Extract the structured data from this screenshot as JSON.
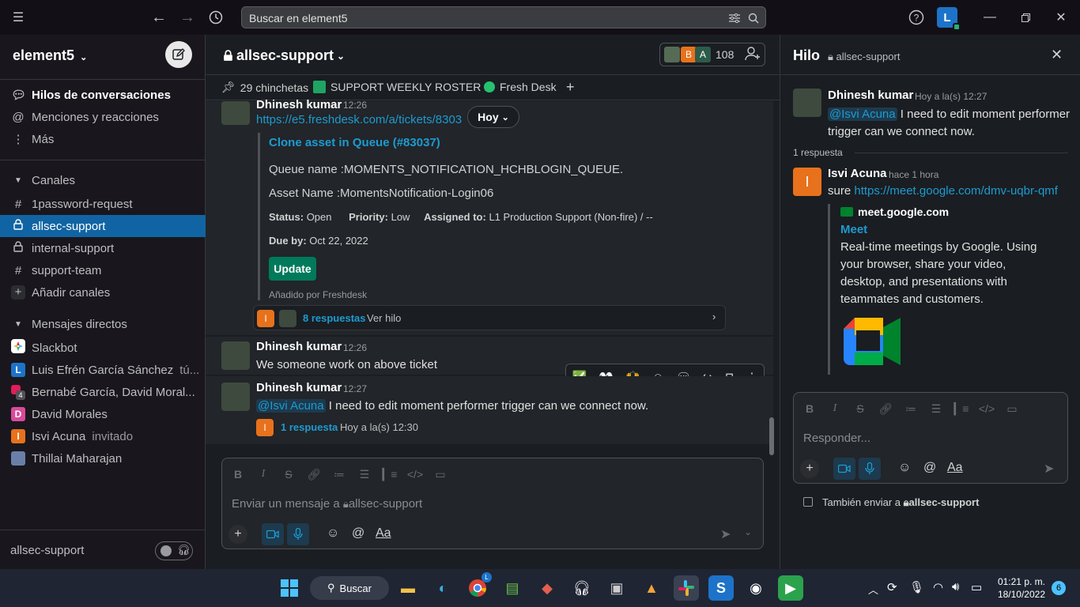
{
  "topbar": {
    "search_placeholder": "Buscar en element5",
    "user_initial": "L"
  },
  "sidebar": {
    "workspace": "element5",
    "nav": [
      {
        "label": "Hilos de conversaciones"
      },
      {
        "label": "Menciones y reacciones"
      },
      {
        "label": "Más"
      }
    ],
    "channels_header": "Canales",
    "channels": [
      {
        "prefix": "#",
        "label": "1password-request"
      },
      {
        "prefix": "lock",
        "label": "allsec-support"
      },
      {
        "prefix": "lock",
        "label": "internal-support"
      },
      {
        "prefix": "#",
        "label": "support-team"
      }
    ],
    "add_channels": "Añadir canales",
    "dm_header": "Mensajes directos",
    "dms": [
      {
        "label": "Slackbot",
        "extra": ""
      },
      {
        "label": "Luis Efrén García Sánchez",
        "extra": "tú..."
      },
      {
        "label": "Bernabé García, David Moral...",
        "extra": "",
        "badge": "4"
      },
      {
        "label": "David Morales",
        "extra": ""
      },
      {
        "label": "Isvi Acuna",
        "extra": "invitado"
      },
      {
        "label": "Thillai Maharajan",
        "extra": ""
      }
    ],
    "huddle_channel": "allsec-support"
  },
  "channel": {
    "name": "allsec-support",
    "member_count": "108",
    "member_initials": [
      "B",
      "A"
    ],
    "pins": "29 chinchetas",
    "bookmark1": "SUPPORT WEEKLY ROSTER ...",
    "bookmark2": "Fresh Desk",
    "date_pill": "Hoy"
  },
  "messages": {
    "m1": {
      "author": "Dhinesh kumar",
      "time": "12:26",
      "link": "https://e5.freshdesk.com/a/tickets/8303",
      "card_title": "Clone asset in Queue (#83037)",
      "queue": "Queue name :MOMENTS_NOTIFICATION_HCHBLOGIN_QUEUE.",
      "asset": "Asset Name :MomentsNotification-Login06",
      "status_label": "Status:",
      "status_value": "Open",
      "priority_label": "Priority:",
      "priority_value": "Low",
      "assigned_label": "Assigned to:",
      "assigned_value": "L1 Production Support (Non-fire) / --",
      "due_label": "Due by:",
      "due_value": "Oct 22, 2022",
      "update_button": "Update",
      "added_by": "Añadido por Freshdesk",
      "replies": "8 respuestas",
      "view_thread": "Ver hilo",
      "reply_initial": "I"
    },
    "m2": {
      "author": "Dhinesh kumar",
      "time": "12:26",
      "text": "We someone work on above ticket"
    },
    "m3": {
      "author": "Dhinesh kumar",
      "time": "12:27",
      "mention": "@Isvi Acuna",
      "text": "I need to edit moment performer trigger can we connect now.",
      "replies": "1 respuesta",
      "reply_time": "Hoy a la(s) 12:30",
      "reply_initial": "I"
    }
  },
  "composer": {
    "placeholder": "Enviar un mensaje a",
    "channel": "allsec-support",
    "aa": "Aa"
  },
  "thread": {
    "title": "Hilo",
    "channel": "allsec-support",
    "parent": {
      "author": "Dhinesh kumar",
      "time": "Hoy a la(s) 12:27",
      "mention": "@Isvi Acuna",
      "text": "I need to edit moment performer trigger can we connect now."
    },
    "reply_count": "1 respuesta",
    "reply": {
      "author": "Isvi Acuna",
      "initial": "I",
      "time": "hace 1 hora",
      "prefix": "sure",
      "link": "https://meet.google.com/dmv-uqbr-qmf",
      "site": "meet.google.com",
      "unfurl_title": "Meet",
      "unfurl_desc_1": "Real-time meetings by Google. Using",
      "unfurl_desc_2": "your browser, share your video,",
      "unfurl_desc_3": "desktop, and presentations with",
      "unfurl_desc_4": "teammates and customers."
    },
    "composer_placeholder": "Responder...",
    "also_send": "También enviar a",
    "also_send_channel": "allsec-support",
    "aa": "Aa"
  },
  "taskbar": {
    "search_label": "Buscar",
    "time": "01:21 p. m.",
    "date": "18/10/2022",
    "notif_count": "6",
    "chrome_badge": "L"
  },
  "colors": {
    "sidebar_active": "#1164a3",
    "link": "#1d9bd1",
    "green": "#007a5a",
    "orange_avatar": "#e8711c"
  }
}
